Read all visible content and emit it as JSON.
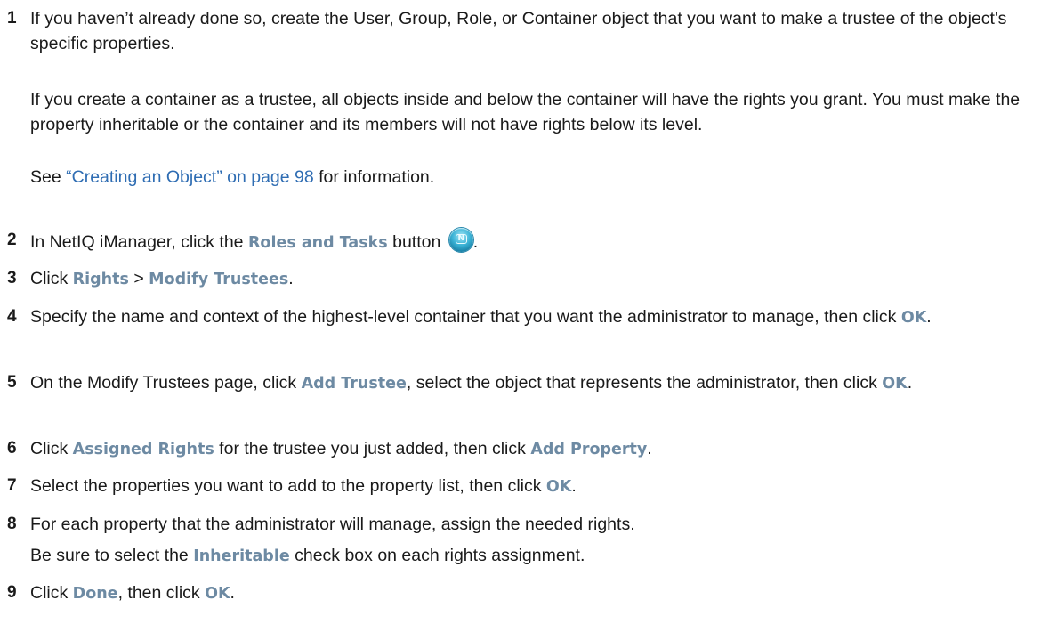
{
  "steps": [
    {
      "num": "1",
      "parts": [
        "If you haven’t already done so, create the User, Group, Role, or Container object that you want to make a trustee of the object's specific properties."
      ]
    },
    {
      "num": "2",
      "t1": "In NetIQ iManager, click the ",
      "ui1": "Roles and Tasks",
      "t2": " button ",
      "t3": ".",
      "icon": "roles-and-tasks-icon"
    },
    {
      "num": "3",
      "t1": "Click ",
      "ui1": "Rights",
      "t2": " > ",
      "ui2": "Modify Trustees",
      "t3": "."
    },
    {
      "num": "4",
      "t1": "Specify the name and context of the highest-level container that you want the administrator to manage, then click ",
      "ui1": "OK",
      "t2": "."
    },
    {
      "num": "5",
      "t1": "On the Modify Trustees page, click ",
      "ui1": "Add Trustee",
      "t2": ", select the object that represents the administrator, then click ",
      "ui2": "OK",
      "t3": "."
    },
    {
      "num": "6",
      "t1": "Click ",
      "ui1": "Assigned Rights",
      "t2": " for the trustee you just added, then click ",
      "ui2": "Add Property",
      "t3": "."
    },
    {
      "num": "7",
      "t1": "Select the properties you want to add to the property list, then click ",
      "ui1": "OK",
      "t2": "."
    },
    {
      "num": "8",
      "t1": "For each property that the administrator will manage, assign the needed rights."
    },
    {
      "num": "9",
      "t1": "Click ",
      "ui1": "Done",
      "t2": ", then click ",
      "ui2": "OK",
      "t3": "."
    }
  ],
  "step1_para2": "If you create a container as a trustee, all objects inside and below the container will have the rights you grant. You must make the property inheritable or the container and its members will not have rights below its level.",
  "step1_para3": {
    "t1": "See ",
    "link": "“Creating an Object” on page 98",
    "t2": " for information."
  },
  "step8_para2": {
    "t1": "Be sure to select the ",
    "ui1": "Inheritable",
    "t2": " check box on each rights assignment."
  },
  "colors": {
    "ui_label": "#6d8aa3",
    "link": "#2f6db3",
    "text": "#1a1a1a"
  }
}
